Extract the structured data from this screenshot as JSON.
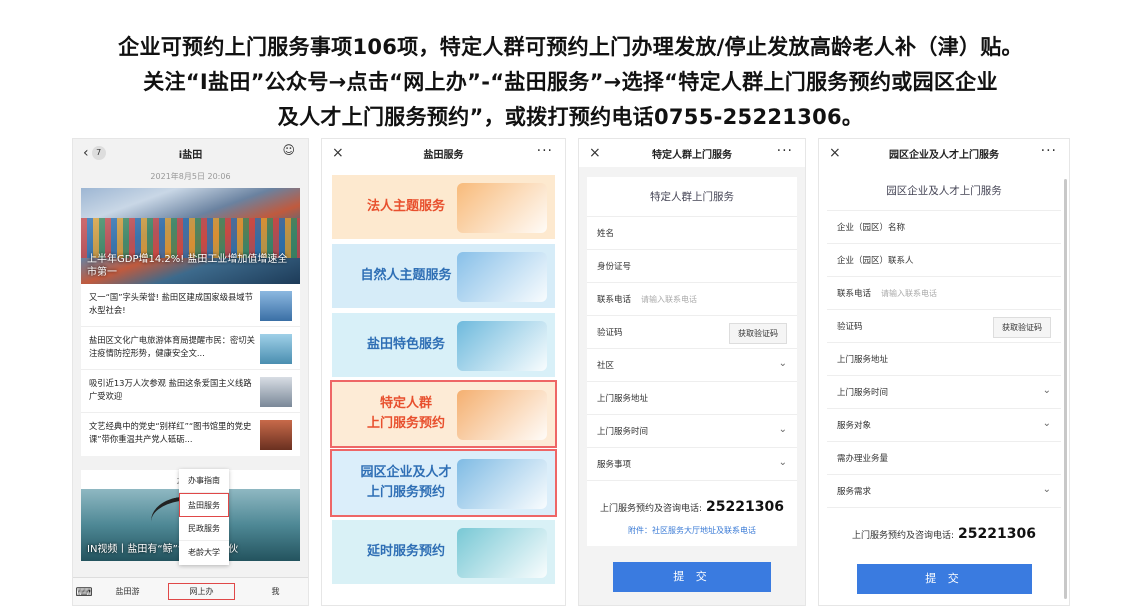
{
  "caption": {
    "line1": "企业可预约上门服务事项106项，特定人群可预约上门办理发放/停止发放高龄老人补（津）贴。",
    "line2": "关注“I盐田”公众号→点击“网上办”-“盐田服务”→选择“特定人群上门服务预约或园区企业",
    "line3": "及人才上门服务预约”，或拨打预约电话0755-25221306。"
  },
  "panel1": {
    "back": "‹",
    "badge": "7",
    "title": "i盐田",
    "user_icon": "user-icon",
    "date1": "2021年8月5日 20:06",
    "hero_caption": "上半年GDP增14.2%! 盐田工业增加值增速全市第一",
    "news": [
      {
        "text": "又一“国”字头荣誉! 盐田区建成国家级县域节水型社会!"
      },
      {
        "text": "盐田区文化广电旅游体育局提醒市民：密切关注疫情防控形势，健康安全文..."
      },
      {
        "text": "吸引近13万人次参观 盐田这条爱国主义线路广受欢迎"
      },
      {
        "text": "文艺经典中的党史“别样红”“图书馆里的党史课”带你重温共产党人砥砺..."
      }
    ],
    "date2": "2021年",
    "hero2_caption": "IN视频丨盐田有“鲸”“布”带着小伙",
    "menu": [
      "办事指南",
      "盐田服务",
      "民政服务",
      "老龄大学"
    ],
    "tabs": [
      "盐田游",
      "网上办",
      "我"
    ]
  },
  "panel2": {
    "close": "×",
    "title": "盐田服务",
    "more": "···",
    "tiles": [
      {
        "label": "法人主题服务",
        "color": "#e8502e",
        "bg": "#fde9cf",
        "art": "#f7b26b"
      },
      {
        "label": "自然人主题服务",
        "color": "#2f6fb5",
        "bg": "#d6ecf8",
        "art": "#7ab8e6"
      },
      {
        "label": "盐田特色服务",
        "color": "#2f6fb5",
        "bg": "#d8f0f8",
        "art": "#5bb0d8"
      },
      {
        "label": "特定人群\n上门服务预约",
        "color": "#e8502e",
        "bg": "#fdebd6",
        "art": "#f3a55e"
      },
      {
        "label": "园区企业及人才\n上门服务预约",
        "color": "#2f6fb5",
        "bg": "#dbeefa",
        "art": "#6fb2e0"
      },
      {
        "label": "延时服务预约",
        "color": "#2f6fb5",
        "bg": "#d9f1f6",
        "art": "#67c1cf"
      }
    ]
  },
  "panel3": {
    "close": "×",
    "title": "特定人群上门服务",
    "more": "···",
    "form_title": "特定人群上门服务",
    "fields": [
      {
        "label": "姓名",
        "placeholder": "",
        "type": "text"
      },
      {
        "label": "身份证号",
        "placeholder": "",
        "type": "text"
      },
      {
        "label": "联系电话",
        "placeholder": "请输入联系电话",
        "type": "text"
      },
      {
        "label": "验证码",
        "placeholder": "",
        "type": "code"
      },
      {
        "label": "社区",
        "placeholder": "",
        "type": "select"
      },
      {
        "label": "上门服务地址",
        "placeholder": "",
        "type": "text"
      },
      {
        "label": "上门服务时间",
        "placeholder": "",
        "type": "select"
      },
      {
        "label": "服务事项",
        "placeholder": "",
        "type": "select"
      }
    ],
    "code_button": "获取验证码",
    "hotline_label": "上门服务预约及咨询电话:",
    "hotline_number": "25221306",
    "annex": "附件：社区服务大厅地址及联系电话",
    "submit": "提 交"
  },
  "panel4": {
    "close": "×",
    "title": "园区企业及人才上门服务",
    "more": "···",
    "form_title": "园区企业及人才上门服务",
    "fields": [
      {
        "label": "企业（园区）名称",
        "placeholder": "",
        "type": "text"
      },
      {
        "label": "企业（园区）联系人",
        "placeholder": "",
        "type": "text"
      },
      {
        "label": "联系电话",
        "placeholder": "请输入联系电话",
        "type": "text"
      },
      {
        "label": "验证码",
        "placeholder": "",
        "type": "code"
      },
      {
        "label": "上门服务地址",
        "placeholder": "",
        "type": "text"
      },
      {
        "label": "上门服务时间",
        "placeholder": "",
        "type": "select"
      },
      {
        "label": "服务对象",
        "placeholder": "",
        "type": "select"
      },
      {
        "label": "需办理业务量",
        "placeholder": "",
        "type": "text"
      },
      {
        "label": "服务需求",
        "placeholder": "",
        "type": "select"
      }
    ],
    "code_button": "获取验证码",
    "hotline_label": "上门服务预约及咨询电话:",
    "hotline_number": "25221306",
    "submit": "提 交"
  }
}
